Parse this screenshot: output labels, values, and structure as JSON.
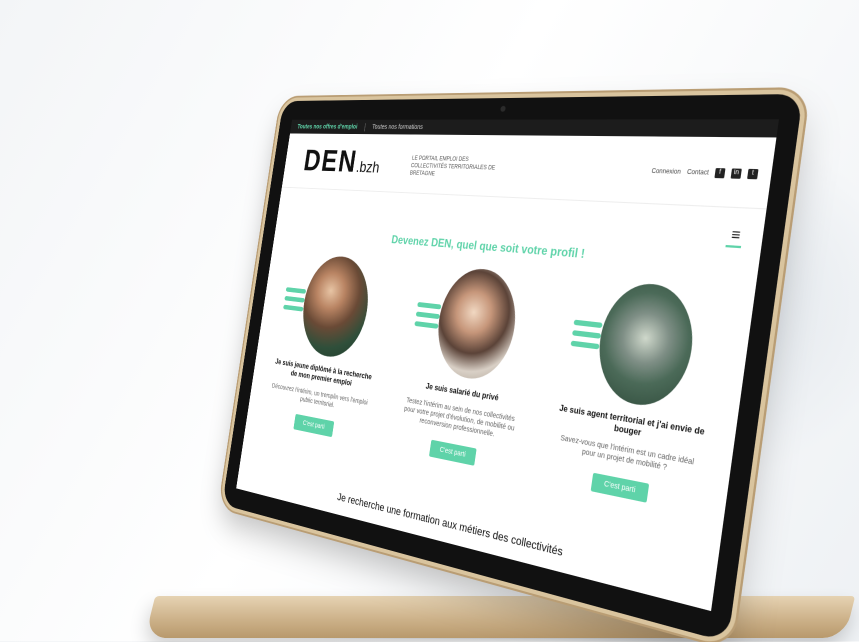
{
  "topbar": {
    "left_link": "Toutes nos offres d'emploi",
    "right_link": "Toutes nos formations"
  },
  "brand": {
    "logo": "DEN",
    "suffix": ".bzh",
    "tagline": "Le portail emploi des collectivités territoriales de Bretagne"
  },
  "header": {
    "account": "Connexion",
    "contact": "Contact",
    "socials": [
      "f",
      "in",
      "t"
    ]
  },
  "menu": {
    "icon": "hamburger-icon"
  },
  "hero": {
    "title": "Devenez DEN, quel que soit votre profil !"
  },
  "cards": [
    {
      "title": "Je suis jeune diplômé à la recherche de mon premier emploi",
      "desc": "Découvrez l'intérim, un tremplin vers l'emploi public territorial.",
      "button": "C'est parti"
    },
    {
      "title": "Je suis salarié du privé",
      "desc": "Testez l'intérim au sein de nos collectivités pour votre projet d'évolution, de mobilité ou reconversion professionnelle.",
      "button": "C'est parti"
    },
    {
      "title": "Je suis agent territorial et j'ai envie de bouger",
      "desc": "Savez-vous que l'intérim est un cadre idéal pour un projet de mobilité ?",
      "button": "C'est parti"
    }
  ],
  "bottom": {
    "title": "Je recherche une formation aux métiers des collectivités"
  },
  "colors": {
    "accent": "#5fd3a9",
    "bezel": "#111111",
    "aluminum": "#d9c49e"
  }
}
